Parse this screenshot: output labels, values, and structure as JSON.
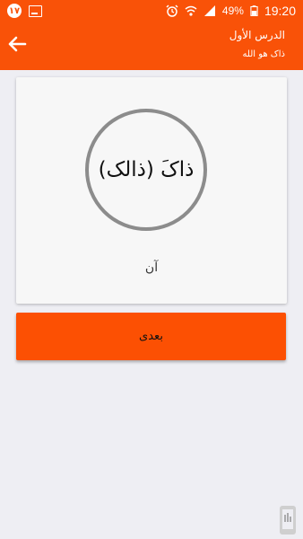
{
  "status_bar": {
    "notification_badge": "١٧",
    "battery_percent": "49%",
    "time": "19:20"
  },
  "app_bar": {
    "title": "الدرس الأول",
    "subtitle": "ذاک هو الله"
  },
  "card": {
    "word": "ذاکَ (ذالک)",
    "meaning": "آن"
  },
  "next_button": {
    "label": "بعدی"
  },
  "colors": {
    "accent": "#f95208",
    "button": "#fc5003",
    "ring": "#8c8c8c",
    "background": "#eeeef3"
  },
  "icons": [
    "notification-badge-icon",
    "gallery-icon",
    "alarm-icon",
    "wifi-icon",
    "signal-icon",
    "battery-icon",
    "back-arrow-icon",
    "brand-logo-icon"
  ]
}
